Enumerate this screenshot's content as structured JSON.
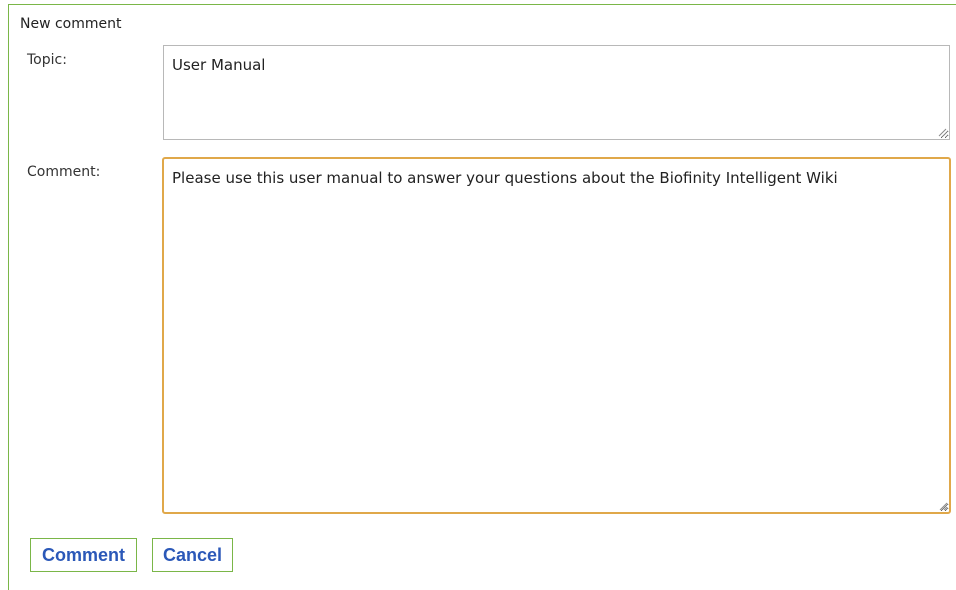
{
  "panel": {
    "title": "New comment"
  },
  "form": {
    "topic_label": "Topic:",
    "topic_value": "User Manual",
    "comment_label": "Comment:",
    "comment_value": "Please use this user manual to answer your questions about the Biofinity Intelligent Wiki"
  },
  "actions": {
    "comment_label": "Comment",
    "cancel_label": "Cancel"
  },
  "icons": {
    "resize_grip": "resize-grip-icon"
  },
  "colors": {
    "panel_border": "#7ab648",
    "focus_border": "#e0a84a",
    "button_text": "#2b58b8",
    "input_border": "#b8b8b8"
  }
}
